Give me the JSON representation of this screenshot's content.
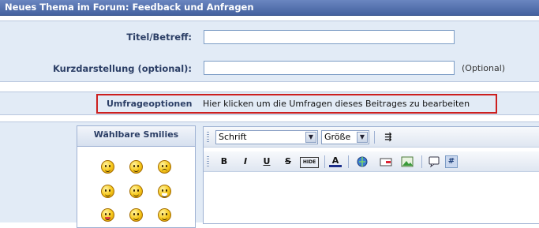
{
  "header": {
    "title": "Neues Thema im Forum: Feedback und Anfragen"
  },
  "form": {
    "title_label": "Titel/Betreff:",
    "title_value": "",
    "summary_label": "Kurzdarstellung (optional):",
    "summary_value": "",
    "summary_hint": "(Optional)"
  },
  "poll": {
    "title": "Umfrageoptionen",
    "text": "Hier klicken um die Umfragen dieses Beitrages zu bearbeiten"
  },
  "smilies": {
    "heading": "Wählbare Smilies",
    "icons": [
      "wink-smiley-icon",
      "cool-smiley-icon",
      "frown-smiley-icon",
      "smile-smiley-icon",
      "confused-smiley-icon",
      "biggrin-smiley-icon",
      "tongue-smiley-icon",
      "mad-smiley-icon",
      "rolleyes-smiley-icon"
    ]
  },
  "editor": {
    "font_select": "Schrift",
    "size_select": "Größe",
    "buttons": [
      "B",
      "I",
      "U",
      "S",
      "HIDE",
      "A"
    ],
    "colors": {
      "accent": "#44619f",
      "highlight": "#cc1f1f"
    }
  }
}
